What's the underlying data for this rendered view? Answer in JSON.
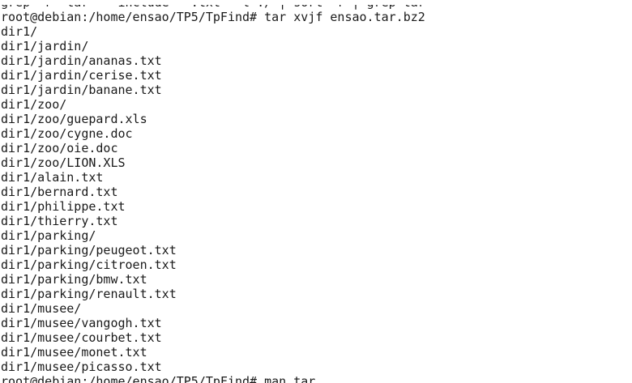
{
  "terminal": {
    "partial_top_line": "grep -r \"tar\" --include=\"*.txt\" -l ./ | sort -r | grep tar",
    "prompt": "root@debian:/home/ensao/TP5/TpFind#",
    "first_command": "tar xvjf ensao.tar.bz2",
    "output": [
      "dir1/",
      "dir1/jardin/",
      "dir1/jardin/ananas.txt",
      "dir1/jardin/cerise.txt",
      "dir1/jardin/banane.txt",
      "dir1/zoo/",
      "dir1/zoo/guepard.xls",
      "dir1/zoo/cygne.doc",
      "dir1/zoo/oie.doc",
      "dir1/zoo/LION.XLS",
      "dir1/alain.txt",
      "dir1/bernard.txt",
      "dir1/philippe.txt",
      "dir1/thierry.txt",
      "dir1/parking/",
      "dir1/parking/peugeot.txt",
      "dir1/parking/citroen.txt",
      "dir1/parking/bmw.txt",
      "dir1/parking/renault.txt",
      "dir1/musee/",
      "dir1/musee/vangogh.txt",
      "dir1/musee/courbet.txt",
      "dir1/musee/monet.txt",
      "dir1/musee/picasso.txt"
    ],
    "last_command": "man tar"
  }
}
